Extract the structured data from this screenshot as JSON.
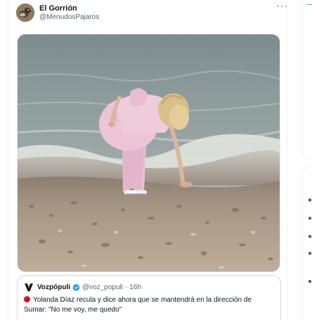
{
  "tweet": {
    "author_name": "El Gorrión",
    "author_handle": "@MenudosPajaros",
    "more_glyph": "···"
  },
  "quoted_tweet": {
    "author_name": "Vozpópuli",
    "author_handle": "@voz_populi",
    "separator": "·",
    "time": "16h",
    "text": "Yolanda Díaz recula y dice ahora que se mantendrá en la dirección de Sumar: \"No me voy, me quedo\"",
    "verified_color": "#1d9bf0",
    "badge_color": "#d5102b",
    "brand_logo_text": "V"
  },
  "right_rail": {
    "fragment_top": "—"
  }
}
